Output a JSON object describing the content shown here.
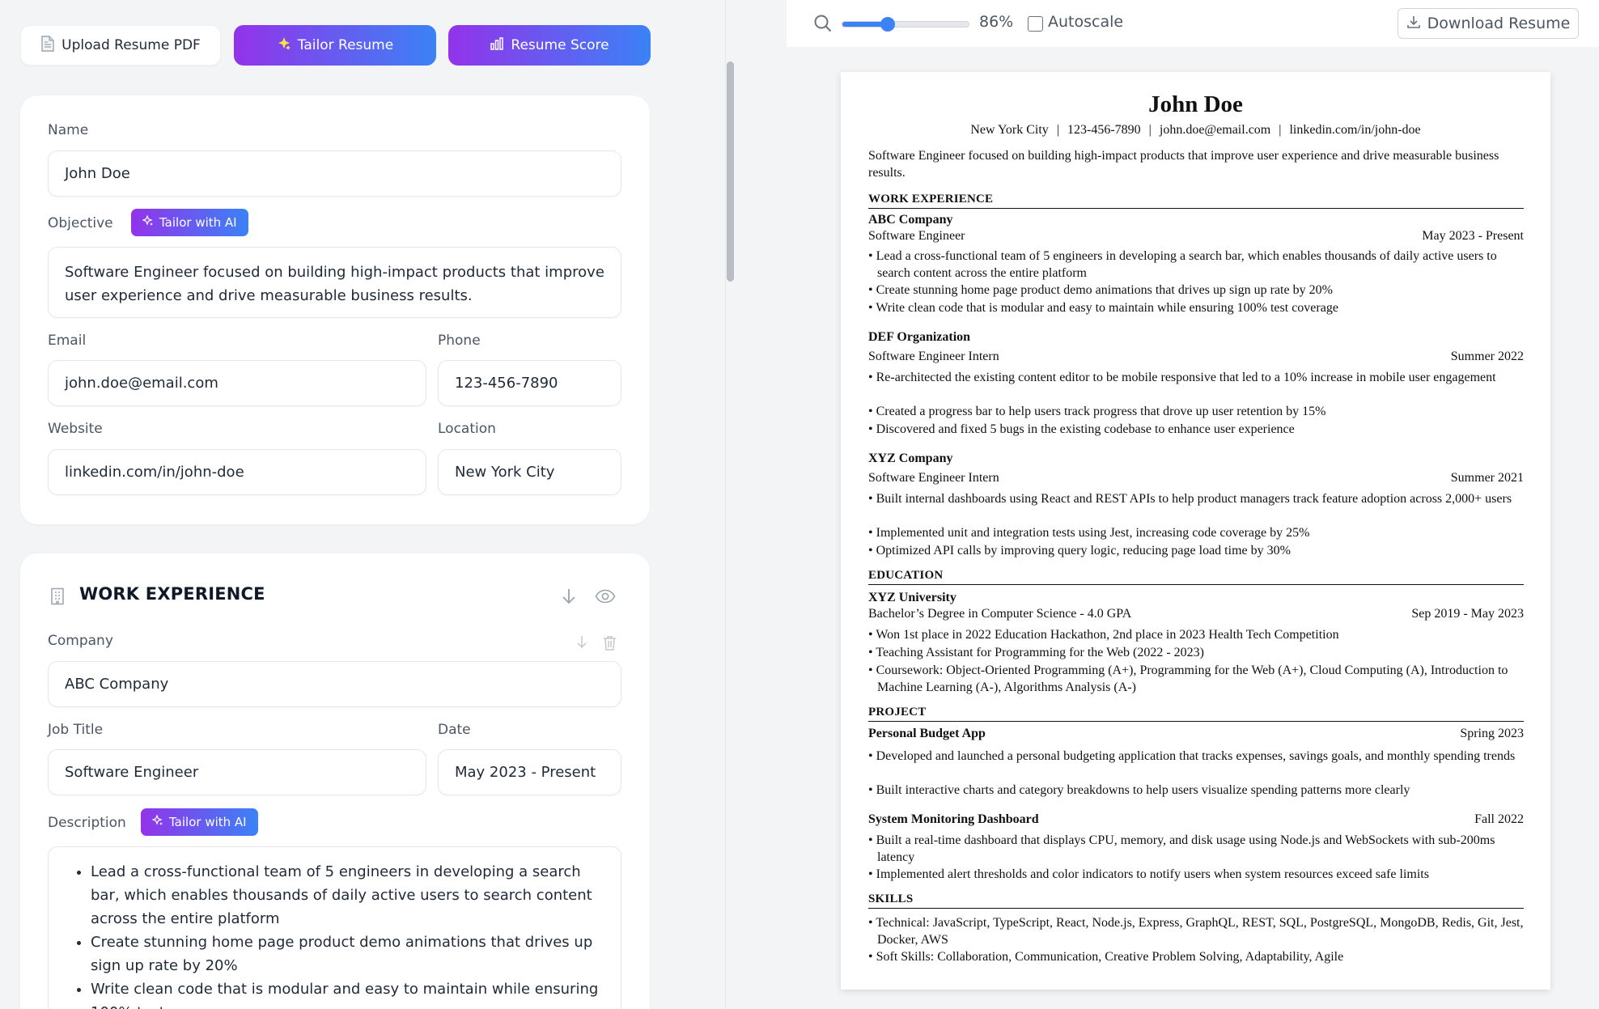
{
  "toolbar": {
    "upload_label": "Upload Resume PDF",
    "tailor_label": "Tailor Resume",
    "score_label": "Resume Score"
  },
  "profile": {
    "name_label": "Name",
    "name_value": "John Doe",
    "objective_label": "Objective",
    "tailor_ai_label": "Tailor with AI",
    "objective_value": "Software Engineer focused on building high-impact products that improve user experience and drive measurable business results.",
    "email_label": "Email",
    "email_value": "john.doe@email.com",
    "phone_label": "Phone",
    "phone_value": "123-456-7890",
    "website_label": "Website",
    "website_value": "linkedin.com/in/john-doe",
    "location_label": "Location",
    "location_value": "New York City"
  },
  "work": {
    "section_title": "WORK EXPERIENCE",
    "company_label": "Company",
    "company_value": "ABC Company",
    "job_title_label": "Job Title",
    "job_title_value": "Software Engineer",
    "date_label": "Date",
    "date_value": "May 2023 - Present",
    "description_label": "Description",
    "tailor_ai_label": "Tailor with AI",
    "bullets": [
      "Lead a cross-functional team of 5 engineers in developing a search bar, which enables thousands of daily active users to search content across the entire platform",
      "Create stunning home page product demo animations that drives up sign up rate by 20%",
      "Write clean code that is modular and easy to maintain while ensuring 100% test coverage"
    ]
  },
  "viewer": {
    "zoom_text": "86%",
    "zoom_level": 0.86,
    "autoscale_label": "Autoscale",
    "download_label": "Download Resume"
  },
  "resume": {
    "name": "John Doe",
    "contact": [
      "New York City",
      "123-456-7890",
      "john.doe@email.com",
      "linkedin.com/in/john-doe"
    ],
    "objective": "Software Engineer focused on building high-impact products that improve user experience and drive measurable business results.",
    "work_heading": "WORK EXPERIENCE",
    "jobs": [
      {
        "company": "ABC Company",
        "title": "Software Engineer",
        "date": "May 2023 - Present",
        "bullets": [
          "Lead a cross-functional team of 5 engineers in developing a search bar, which enables thousands of daily active users to search content across the entire platform",
          "Create stunning home page product demo animations that drives up sign up rate by 20%",
          "Write clean code that is modular and easy to maintain while ensuring 100% test coverage"
        ]
      },
      {
        "company": "DEF Organization",
        "title": "Software Engineer Intern",
        "date": "Summer 2022",
        "bullets": [
          "Re-architected the existing content editor to be mobile responsive that led to a 10% increase in mobile user engagement",
          "Created a progress bar to help users track progress that drove up user retention by 15%",
          "Discovered and fixed 5 bugs in the existing codebase to enhance user experience"
        ]
      },
      {
        "company": "XYZ Company",
        "title": "Software Engineer Intern",
        "date": "Summer 2021",
        "bullets": [
          "Built internal dashboards using React and REST APIs to help product managers track feature adoption across 2,000+ users",
          "Implemented unit and integration tests using Jest, increasing code coverage by 25%",
          "Optimized API calls by improving query logic, reducing page load time by 30%"
        ]
      }
    ],
    "education_heading": "EDUCATION",
    "school": "XYZ University",
    "degree": "Bachelor’s Degree in Computer Science - 4.0 GPA",
    "edu_date": "Sep 2019 - May 2023",
    "edu_bullets": [
      "Won 1st place in 2022 Education Hackathon, 2nd place in 2023 Health Tech Competition",
      "Teaching Assistant for Programming for the Web (2022 - 2023)",
      "Coursework: Object-Oriented Programming (A+), Programming for the Web (A+), Cloud Computing (A), Introduction to Machine Learning (A-), Algorithms Analysis (A-)"
    ],
    "project_heading": "PROJECT",
    "projects": [
      {
        "name": "Personal Budget App",
        "date": "Spring 2023",
        "bullets": [
          "Developed and launched a personal budgeting application that tracks expenses, savings goals, and monthly spending trends",
          "Built interactive charts and category breakdowns to help users visualize spending patterns more clearly"
        ]
      },
      {
        "name": "System Monitoring Dashboard",
        "date": "Fall 2022",
        "bullets": [
          "Built a real-time dashboard that displays CPU, memory, and disk usage using Node.js and WebSockets with sub-200ms latency",
          "Implemented alert thresholds and color indicators to notify users when system resources exceed safe limits"
        ]
      }
    ],
    "skills_heading": "SKILLS",
    "skills": [
      "Technical: JavaScript, TypeScript, React, Node.js, Express, GraphQL, REST, SQL, PostgreSQL, MongoDB, Redis, Git, Jest, Docker, AWS",
      "Soft Skills: Collaboration, Communication, Creative Problem Solving, Adaptability, Agile"
    ]
  }
}
